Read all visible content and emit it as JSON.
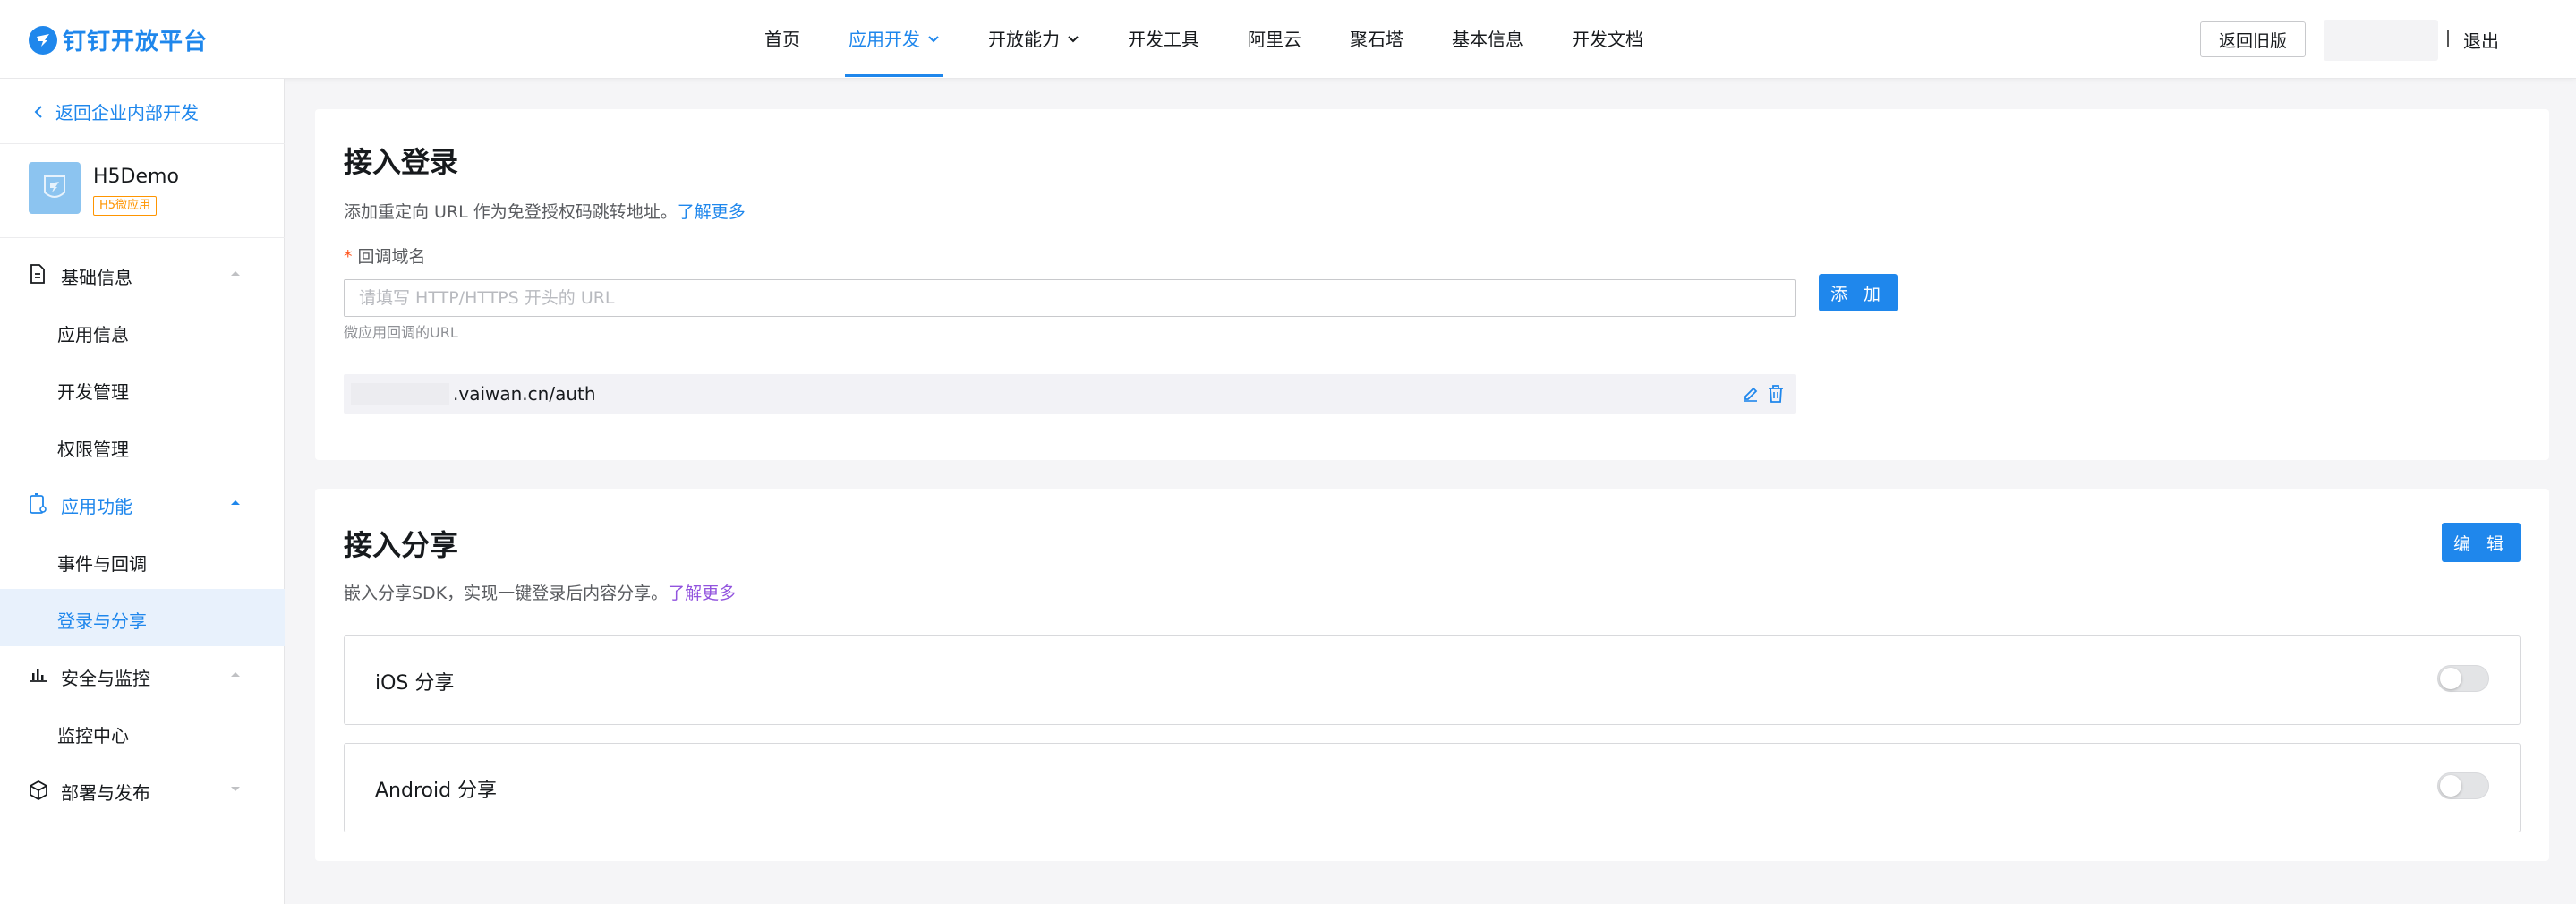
{
  "brand": {
    "name": "钉钉开放平台",
    "color": "#1f87ec"
  },
  "nav": {
    "items": [
      {
        "label": "首页",
        "active": false,
        "dropdown": false
      },
      {
        "label": "应用开发",
        "active": true,
        "dropdown": true
      },
      {
        "label": "开放能力",
        "active": false,
        "dropdown": true
      },
      {
        "label": "开发工具",
        "active": false,
        "dropdown": false
      },
      {
        "label": "阿里云",
        "active": false,
        "dropdown": false
      },
      {
        "label": "聚石塔",
        "active": false,
        "dropdown": false
      },
      {
        "label": "基本信息",
        "active": false,
        "dropdown": false
      },
      {
        "label": "开发文档",
        "active": false,
        "dropdown": false
      }
    ],
    "old_version_label": "返回旧版",
    "logout_label": "退出"
  },
  "sidebar": {
    "back_label": "返回企业内部开发",
    "app": {
      "name": "H5Demo",
      "tag": "H5微应用"
    },
    "groups": [
      {
        "label": "基础信息",
        "icon": "document-icon",
        "open": false,
        "items": [
          "应用信息",
          "开发管理",
          "权限管理"
        ]
      },
      {
        "label": "应用功能",
        "icon": "app-function-icon",
        "open": true,
        "items": [
          "事件与回调",
          "登录与分享"
        ]
      },
      {
        "label": "安全与监控",
        "icon": "bar-chart-icon",
        "open": false,
        "items": [
          "监控中心"
        ]
      },
      {
        "label": "部署与发布",
        "icon": "cube-icon",
        "open": false,
        "items": []
      }
    ],
    "active_item": "登录与分享"
  },
  "login": {
    "title": "接入登录",
    "desc": "添加重定向 URL 作为免登授权码跳转地址。",
    "learn_more": "了解更多",
    "field_label": "回调域名",
    "input_placeholder": "请填写 HTTP/HTTPS 开头的 URL",
    "add_label": "添 加",
    "hint": "微应用回调的URL",
    "urls": [
      ".vaiwan.cn/auth"
    ]
  },
  "share": {
    "title": "接入分享",
    "edit_label": "编 辑",
    "desc": "嵌入分享SDK，实现一键登录后内容分享。",
    "learn_more": "了解更多",
    "items": [
      {
        "label": "iOS 分享",
        "enabled": false
      },
      {
        "label": "Android 分享",
        "enabled": false
      }
    ]
  }
}
